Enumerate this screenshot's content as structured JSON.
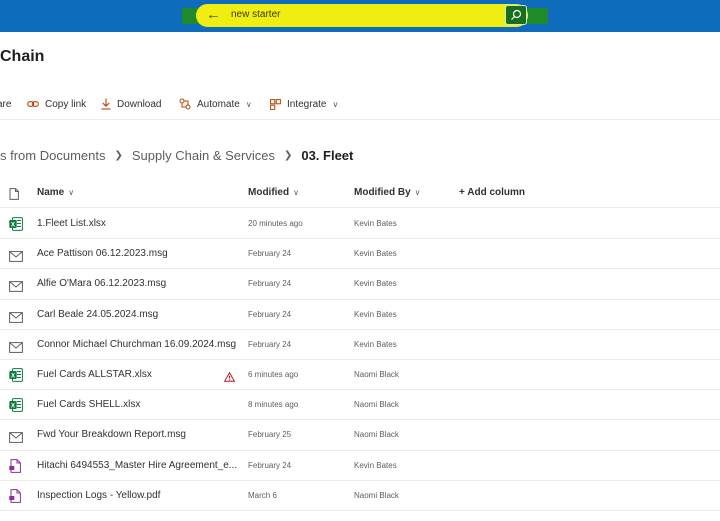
{
  "search": {
    "value": "new starter",
    "back_icon": "arrow-left-icon",
    "submit_icon": "search-icon"
  },
  "site": {
    "title": "Chain"
  },
  "commands": [
    {
      "label": "are",
      "icon": "share-icon"
    },
    {
      "label": "Copy link",
      "icon": "link-icon"
    },
    {
      "label": "Download",
      "icon": "download-icon"
    },
    {
      "label": "Automate",
      "icon": "automate-icon"
    },
    {
      "label": "Integrate",
      "icon": "integrate-icon"
    }
  ],
  "breadcrumb": {
    "items": [
      "s from Documents",
      "Supply Chain & Services"
    ],
    "current": "03. Fleet"
  },
  "columns": {
    "name": "Name",
    "modified": "Modified",
    "modified_by": "Modified By",
    "add_column": "+ Add column"
  },
  "files": [
    {
      "name": "1.Fleet List.xlsx",
      "modified": "20 minutes ago",
      "modified_by": "Kevin Bates",
      "type": "excel"
    },
    {
      "name": "Ace Pattison 06.12.2023.msg",
      "modified": "February 24",
      "modified_by": "Kevin Bates",
      "type": "mail"
    },
    {
      "name": "Alfie O'Mara 06.12.2023.msg",
      "modified": "February 24",
      "modified_by": "Kevin Bates",
      "type": "mail"
    },
    {
      "name": "Carl Beale 24.05.2024.msg",
      "modified": "February 24",
      "modified_by": "Kevin Bates",
      "type": "mail"
    },
    {
      "name": "Connor Michael Churchman 16.09.2024.msg",
      "modified": "February 24",
      "modified_by": "Kevin Bates",
      "type": "mail"
    },
    {
      "name": "Fuel Cards ALLSTAR.xlsx",
      "modified": "6 minutes ago",
      "modified_by": "Naomi Black",
      "type": "excel",
      "warning": true
    },
    {
      "name": "Fuel Cards SHELL.xlsx",
      "modified": "8 minutes ago",
      "modified_by": "Naomi Black",
      "type": "excel"
    },
    {
      "name": "Fwd  Your Breakdown Report.msg",
      "modified": "February 25",
      "modified_by": "Naomi Black",
      "type": "mail"
    },
    {
      "name": "Hitachi 6494553_Master Hire Agreement_e...",
      "modified": "February 24",
      "modified_by": "Kevin Bates",
      "type": "pdf"
    },
    {
      "name": "Inspection Logs - Yellow.pdf",
      "modified": "March 6",
      "modified_by": "Naomi Black",
      "type": "pdf"
    }
  ],
  "colors": {
    "topbar": "#0f6cbd",
    "accent": "#b64500",
    "excel": "#107c41",
    "pdf": "#8c2f9b"
  }
}
